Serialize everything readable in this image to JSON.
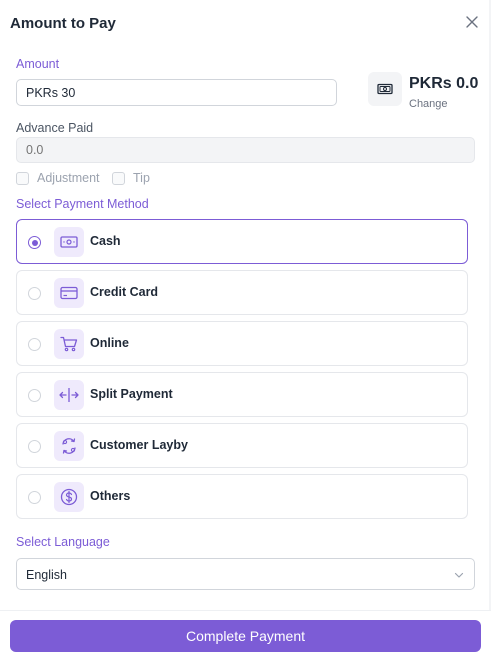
{
  "header": {
    "title": "Amount to Pay"
  },
  "amount": {
    "label": "Amount",
    "value": "PKRs 30"
  },
  "change": {
    "amount": "PKRs 0.0",
    "label": "Change"
  },
  "advance": {
    "label": "Advance Paid",
    "placeholder": "0.0"
  },
  "options": {
    "adjustment": "Adjustment",
    "tip": "Tip"
  },
  "payment": {
    "label": "Select Payment Method",
    "selected": "Cash",
    "methods": [
      {
        "label": "Cash",
        "icon": "cash-icon"
      },
      {
        "label": "Credit Card",
        "icon": "credit-card-icon"
      },
      {
        "label": "Online",
        "icon": "cart-icon"
      },
      {
        "label": "Split Payment",
        "icon": "split-arrows-icon"
      },
      {
        "label": "Customer Layby",
        "icon": "cycle-icon"
      },
      {
        "label": "Others",
        "icon": "dollar-circle-icon"
      }
    ]
  },
  "language": {
    "label": "Select Language",
    "value": "English"
  },
  "footer": {
    "complete_label": "Complete Payment"
  },
  "colors": {
    "accent": "#7c5cd6",
    "accent_bg": "#efeafc"
  }
}
